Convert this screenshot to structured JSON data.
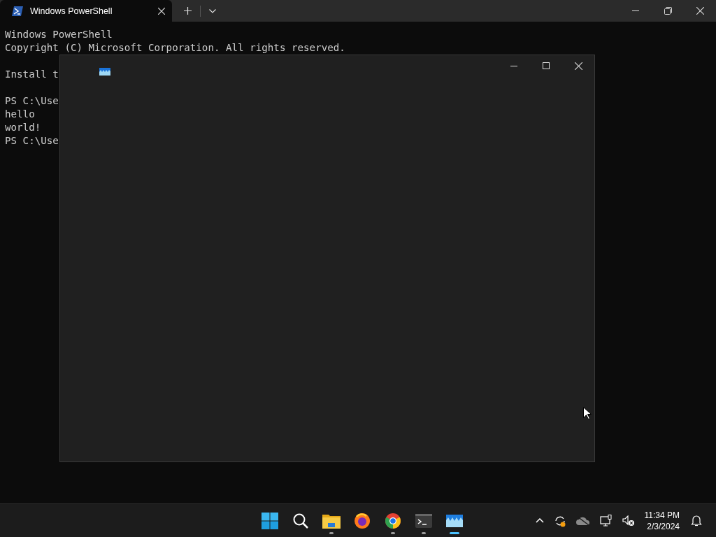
{
  "terminal": {
    "tab": {
      "title": "Windows PowerShell",
      "selected": true
    },
    "blocks": [
      [
        "Windows PowerShell",
        "Copyright (C) Microsoft Corporation. All rights reserved."
      ],
      [
        "Install t"
      ],
      [
        "PS C:\\Use",
        "hello",
        "world!",
        "PS C:\\Use"
      ]
    ]
  },
  "taskbar": {
    "apps": [
      {
        "kind": "start",
        "running": false,
        "selected": false
      },
      {
        "kind": "search",
        "running": false,
        "selected": false
      },
      {
        "kind": "files",
        "running": true,
        "selected": false
      },
      {
        "kind": "firefox",
        "running": false,
        "selected": false
      },
      {
        "kind": "chrome",
        "running": true,
        "selected": false
      },
      {
        "kind": "terminal",
        "running": true,
        "selected": false
      },
      {
        "kind": "wave",
        "running": true,
        "selected": true
      }
    ],
    "tray": [
      {
        "kind": "chevron"
      },
      {
        "kind": "sync"
      },
      {
        "kind": "cloud"
      },
      {
        "kind": "network"
      },
      {
        "kind": "sound"
      }
    ],
    "time": "11:34 PM",
    "date": "2/3/2024"
  }
}
